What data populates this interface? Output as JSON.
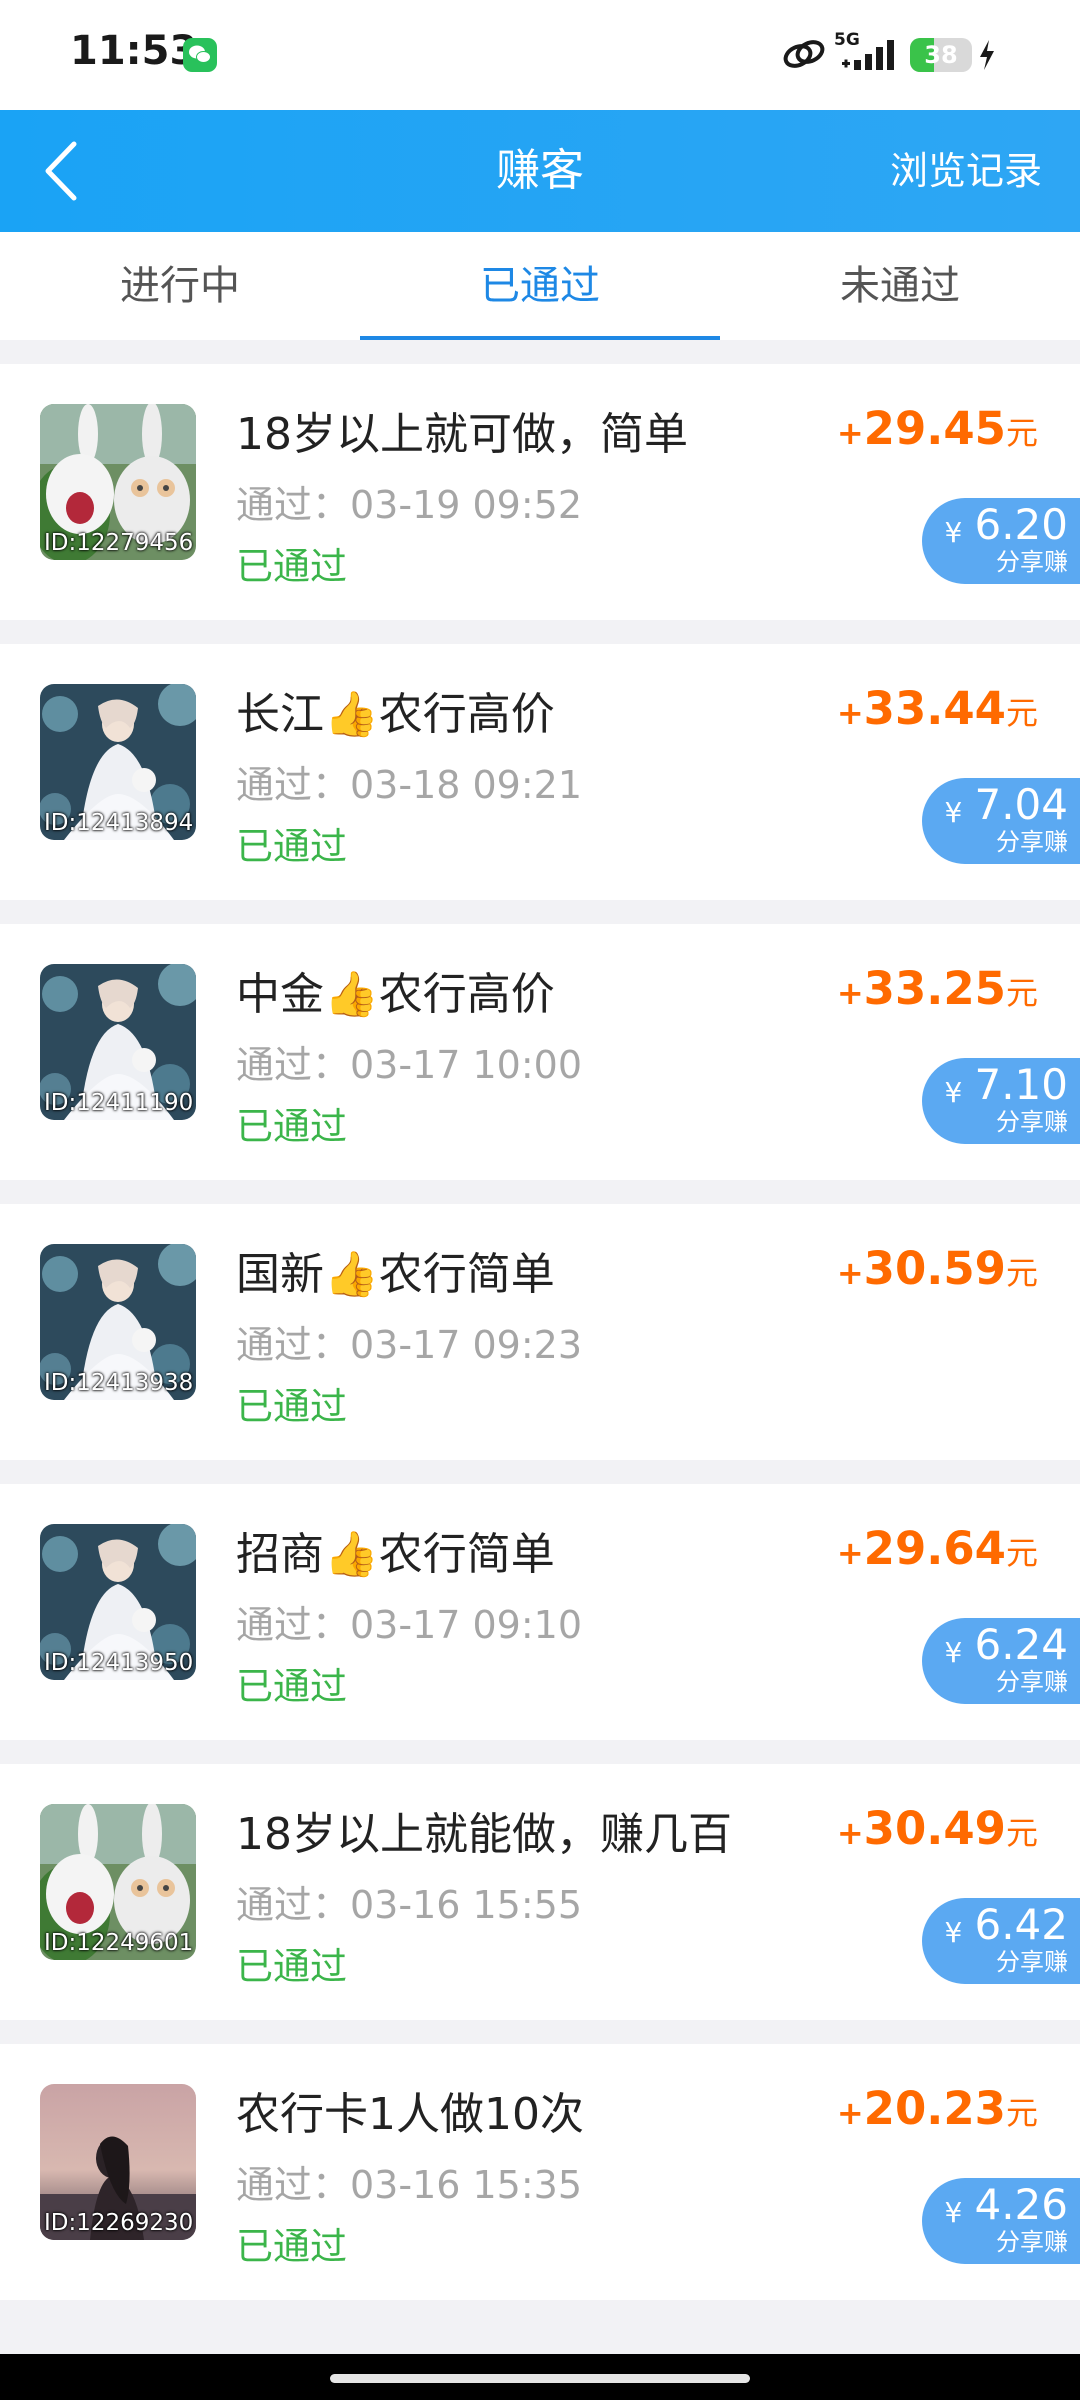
{
  "status_bar": {
    "time": "11:53",
    "network": "5G",
    "battery": "38",
    "battery_level": 0.38
  },
  "header": {
    "title": "赚客",
    "history": "浏览记录",
    "back_icon": "chevron-left-icon"
  },
  "tabs": [
    {
      "label": "进行中",
      "active": false
    },
    {
      "label": "已通过",
      "active": true
    },
    {
      "label": "未通过",
      "active": false
    }
  ],
  "colors": {
    "accent": "#1e88e5",
    "header": "#1aa3f5",
    "amount": "#ff6a00",
    "passed": "#3bb54a",
    "share_bg": "#5ba9f2"
  },
  "tasks": [
    {
      "thumb_id": "ID:12279456",
      "thumb": "rabbit",
      "title": "18岁以上就可做，简单",
      "time": "通过：03-19 09:52",
      "status": "已通过",
      "plus": "+",
      "amount": "29.45",
      "unit": "元",
      "share_yen": "¥",
      "share_amount": "6.20",
      "share_label": "分享赚"
    },
    {
      "thumb_id": "ID:12413894",
      "thumb": "bride",
      "title": "长江👍农行高价",
      "time": "通过：03-18 09:21",
      "status": "已通过",
      "plus": "+",
      "amount": "33.44",
      "unit": "元",
      "share_yen": "¥",
      "share_amount": "7.04",
      "share_label": "分享赚"
    },
    {
      "thumb_id": "ID:12411190",
      "thumb": "bride",
      "title": "中金👍农行高价",
      "time": "通过：03-17 10:00",
      "status": "已通过",
      "plus": "+",
      "amount": "33.25",
      "unit": "元",
      "share_yen": "¥",
      "share_amount": "7.10",
      "share_label": "分享赚"
    },
    {
      "thumb_id": "ID:12413938",
      "thumb": "bride",
      "title": "国新👍农行简单",
      "time": "通过：03-17 09:23",
      "status": "已通过",
      "plus": "+",
      "amount": "30.59",
      "unit": "元",
      "share_yen": "",
      "share_amount": "",
      "share_label": ""
    },
    {
      "thumb_id": "ID:12413950",
      "thumb": "bride",
      "title": "招商👍农行简单",
      "time": "通过：03-17 09:10",
      "status": "已通过",
      "plus": "+",
      "amount": "29.64",
      "unit": "元",
      "share_yen": "¥",
      "share_amount": "6.24",
      "share_label": "分享赚"
    },
    {
      "thumb_id": "ID:12249601",
      "thumb": "rabbit",
      "title": "18岁以上就能做，赚几百",
      "time": "通过：03-16 15:55",
      "status": "已通过",
      "plus": "+",
      "amount": "30.49",
      "unit": "元",
      "share_yen": "¥",
      "share_amount": "6.42",
      "share_label": "分享赚"
    },
    {
      "thumb_id": "ID:12269230",
      "thumb": "sunset",
      "title": "农行卡1人做10次",
      "time": "通过：03-16 15:35",
      "status": "已通过",
      "plus": "+",
      "amount": "20.23",
      "unit": "元",
      "share_yen": "¥",
      "share_amount": "4.26",
      "share_label": "分享赚"
    }
  ]
}
